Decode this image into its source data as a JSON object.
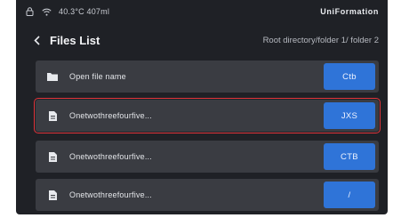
{
  "status_bar": {
    "info": "40.3°C 407ml",
    "brand": "UniFormation"
  },
  "header": {
    "title": "Files List",
    "breadcrumb": "Root directory/folder 1/ folder 2"
  },
  "files": [
    {
      "label": "Open file name",
      "type": "Ctb",
      "icon": "folder-icon",
      "selected": false
    },
    {
      "label": "Onetwothreefourfive...",
      "type": "JXS",
      "icon": "document-icon",
      "selected": true
    },
    {
      "label": "Onetwothreefourfive...",
      "type": "CTB",
      "icon": "document-icon",
      "selected": false
    },
    {
      "label": "Onetwothreefourfive...",
      "type": "/",
      "icon": "document-icon",
      "selected": false
    }
  ],
  "colors": {
    "screen_bg": "#1f2126",
    "row_bg": "#3a3c42",
    "accent": "#2f74d8",
    "selection": "#e0343a"
  }
}
